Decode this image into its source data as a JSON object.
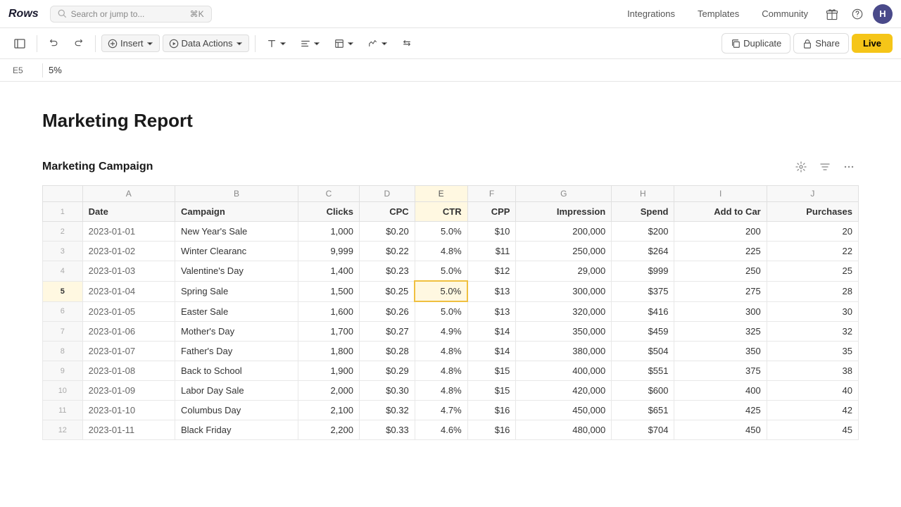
{
  "app": {
    "logo": "Rows",
    "search_placeholder": "Search or jump to...",
    "search_shortcut": "⌘K"
  },
  "nav": {
    "integrations": "Integrations",
    "templates": "Templates",
    "community": "Community",
    "avatar_initial": "H"
  },
  "toolbar": {
    "insert_label": "Insert",
    "data_actions_label": "Data Actions",
    "duplicate_label": "Duplicate",
    "share_label": "Share",
    "live_label": "Live"
  },
  "cell_ref": {
    "ref": "E5",
    "value": "5%"
  },
  "page_title": "Marketing Report",
  "table_title": "Marketing Campaign",
  "columns": [
    "A",
    "B",
    "C",
    "D",
    "E",
    "F",
    "G",
    "H",
    "I",
    "J"
  ],
  "col_headers": [
    "Date",
    "Campaign",
    "Clicks",
    "CPC",
    "CTR",
    "CPP",
    "Impression",
    "Spend",
    "Add to Car",
    "Purchases"
  ],
  "rows": [
    {
      "num": 2,
      "date": "2023-01-01",
      "campaign": "New Year's Sale",
      "clicks": "1,000",
      "cpc": "$0.20",
      "ctr": "5.0%",
      "cpp": "$10",
      "impression": "200,000",
      "spend": "$200",
      "addtocar": "200",
      "purchases": "20"
    },
    {
      "num": 3,
      "date": "2023-01-02",
      "campaign": "Winter Clearanc",
      "clicks": "9,999",
      "cpc": "$0.22",
      "ctr": "4.8%",
      "cpp": "$11",
      "impression": "250,000",
      "spend": "$264",
      "addtocar": "225",
      "purchases": "22"
    },
    {
      "num": 4,
      "date": "2023-01-03",
      "campaign": "Valentine's Day",
      "clicks": "1,400",
      "cpc": "$0.23",
      "ctr": "5.0%",
      "cpp": "$12",
      "impression": "29,000",
      "spend": "$999",
      "addtocar": "250",
      "purchases": "25"
    },
    {
      "num": 5,
      "date": "2023-01-04",
      "campaign": "Spring Sale",
      "clicks": "1,500",
      "cpc": "$0.25",
      "ctr": "5.0%",
      "cpp": "$13",
      "impression": "300,000",
      "spend": "$375",
      "addtocar": "275",
      "purchases": "28",
      "active": true
    },
    {
      "num": 6,
      "date": "2023-01-05",
      "campaign": "Easter Sale",
      "clicks": "1,600",
      "cpc": "$0.26",
      "ctr": "5.0%",
      "cpp": "$13",
      "impression": "320,000",
      "spend": "$416",
      "addtocar": "300",
      "purchases": "30"
    },
    {
      "num": 7,
      "date": "2023-01-06",
      "campaign": "Mother's Day",
      "clicks": "1,700",
      "cpc": "$0.27",
      "ctr": "4.9%",
      "cpp": "$14",
      "impression": "350,000",
      "spend": "$459",
      "addtocar": "325",
      "purchases": "32"
    },
    {
      "num": 8,
      "date": "2023-01-07",
      "campaign": "Father's Day",
      "clicks": "1,800",
      "cpc": "$0.28",
      "ctr": "4.8%",
      "cpp": "$14",
      "impression": "380,000",
      "spend": "$504",
      "addtocar": "350",
      "purchases": "35"
    },
    {
      "num": 9,
      "date": "2023-01-08",
      "campaign": "Back to School",
      "clicks": "1,900",
      "cpc": "$0.29",
      "ctr": "4.8%",
      "cpp": "$15",
      "impression": "400,000",
      "spend": "$551",
      "addtocar": "375",
      "purchases": "38"
    },
    {
      "num": 10,
      "date": "2023-01-09",
      "campaign": "Labor Day Sale",
      "clicks": "2,000",
      "cpc": "$0.30",
      "ctr": "4.8%",
      "cpp": "$15",
      "impression": "420,000",
      "spend": "$600",
      "addtocar": "400",
      "purchases": "40"
    },
    {
      "num": 11,
      "date": "2023-01-10",
      "campaign": "Columbus Day",
      "clicks": "2,100",
      "cpc": "$0.32",
      "ctr": "4.7%",
      "cpp": "$16",
      "impression": "450,000",
      "spend": "$651",
      "addtocar": "425",
      "purchases": "42"
    },
    {
      "num": 12,
      "date": "2023-01-11",
      "campaign": "Black Friday",
      "clicks": "2,200",
      "cpc": "$0.33",
      "ctr": "4.6%",
      "cpp": "$16",
      "impression": "480,000",
      "spend": "$704",
      "addtocar": "450",
      "purchases": "45"
    }
  ]
}
